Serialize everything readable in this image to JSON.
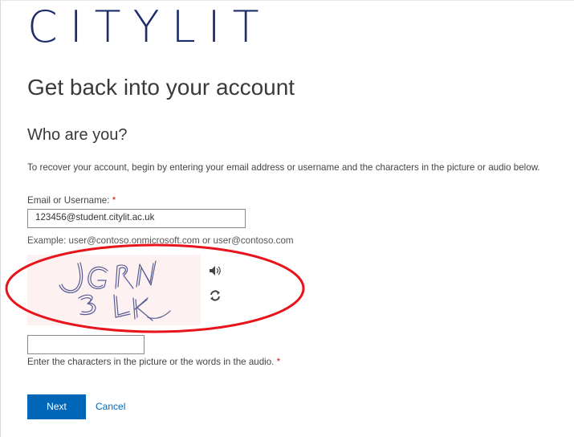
{
  "brand": {
    "logo_text": "CITYLIT",
    "logo_color": "#1e2d6a"
  },
  "page": {
    "title": "Get back into your account",
    "subtitle": "Who are you?",
    "intro": "To recover your account, begin by entering your email address or username and the characters in the picture or audio below."
  },
  "form": {
    "email_label": "Email or Username:",
    "required_marker": "*",
    "email_value": "123456@student.citylit.ac.uk",
    "example_text": "Example: user@contoso.onmicrosoft.com or user@contoso.com",
    "captcha": {
      "image_text": "JGRN 3LK",
      "audio_icon": "speaker-icon",
      "refresh_icon": "refresh-icon",
      "input_value": "",
      "label": "Enter the characters in the picture or the words in the audio."
    }
  },
  "actions": {
    "next_label": "Next",
    "cancel_label": "Cancel"
  },
  "annotation": {
    "type": "red-oval-highlight",
    "color": "#e8141b"
  },
  "colors": {
    "accent": "#0067b8",
    "required": "#c41a1a"
  }
}
